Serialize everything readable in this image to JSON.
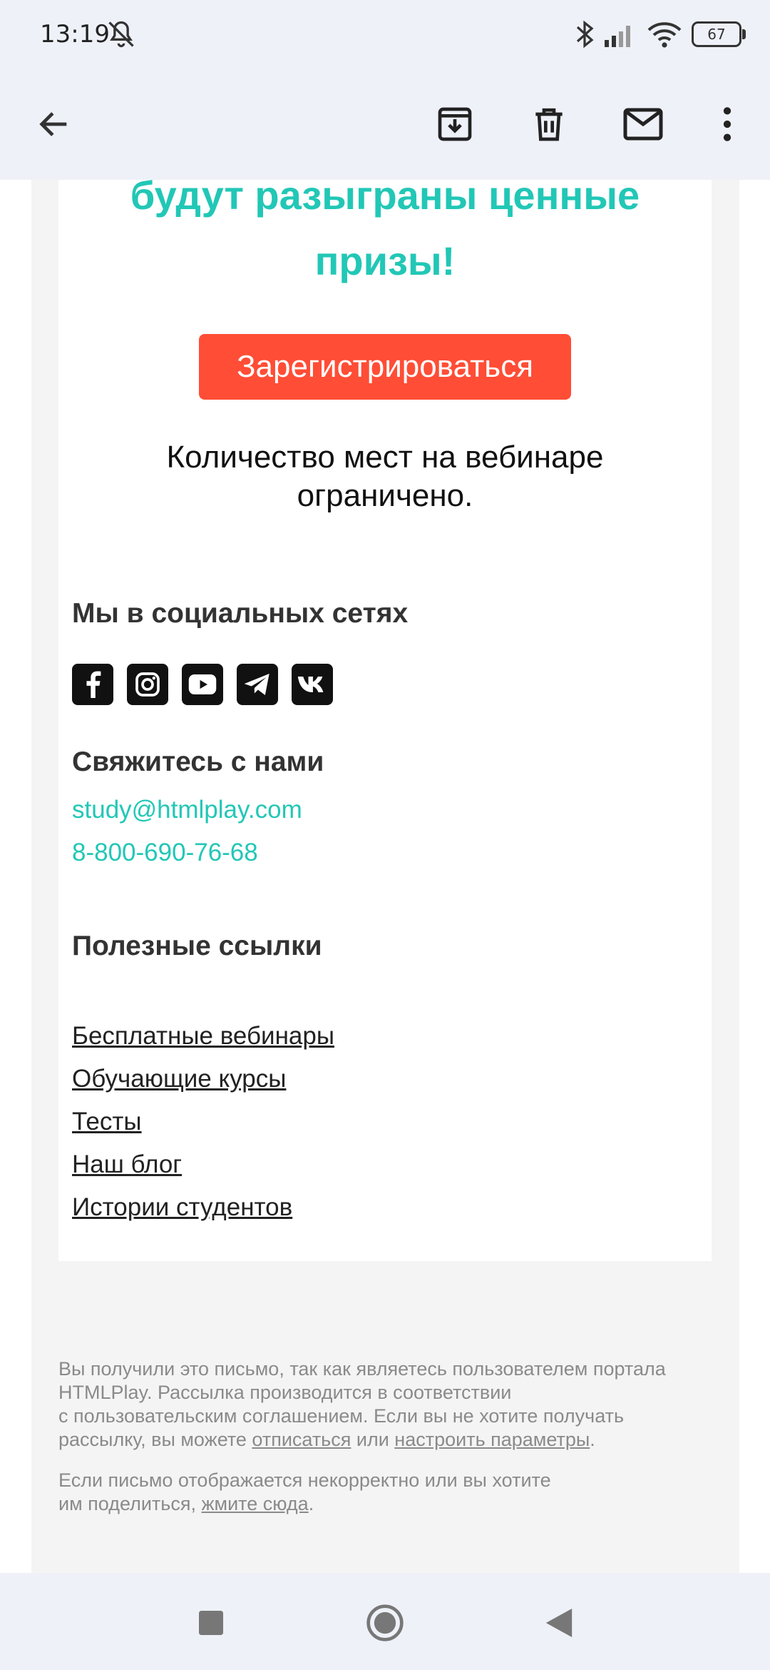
{
  "status_bar": {
    "time": "13:19",
    "battery": "67",
    "icons": [
      "bell-off-icon",
      "bluetooth-icon",
      "signal-icon",
      "wifi-icon",
      "battery-icon"
    ]
  },
  "toolbar": {
    "icons": [
      "back-arrow-icon",
      "archive-icon",
      "trash-icon",
      "mail-icon",
      "more-vert-icon"
    ]
  },
  "email": {
    "promo_line1": "будут разыграны ценные",
    "promo_line2": "призы!",
    "register_button": "Зарегистрироваться",
    "seats_line1": "Количество мест на вебинаре",
    "seats_line2": "ограничено.",
    "social_heading": "Мы в социальных сетях",
    "social_icons": [
      "facebook-icon",
      "instagram-icon",
      "youtube-icon",
      "telegram-icon",
      "vk-icon"
    ],
    "contact_heading": "Свяжитесь с нами",
    "contact_email": "study@htmlplay.com",
    "contact_phone": "8-800-690-76-68",
    "links_heading": "Полезные ссылки",
    "links": [
      "Бесплатные вебинары",
      "Обучающие курсы",
      "Тесты",
      "Наш блог",
      "Истории студентов"
    ],
    "legal1": {
      "line1": "Вы получили это письмо, так как являетесь пользователем портала",
      "line2": "HTMLPlay. Рассылка производится в соответствии",
      "line3": "с пользовательским соглашением. Если вы не хотите получать",
      "line4_prefix": "рассылку, вы можете ",
      "unsubscribe": "отписаться",
      "or": " или ",
      "settings": "настроить параметры",
      "dot": "."
    },
    "legal2": {
      "line1": "Если письмо отображается некорректно или вы хотите",
      "line2_prefix": "им поделиться, ",
      "click_here": "жмите сюда",
      "dot": "."
    }
  },
  "colors": {
    "accent": "#22c7b6",
    "button": "#ff4d36",
    "chrome_bg": "#eef1f8",
    "outer_bg": "#f4f4f4"
  }
}
